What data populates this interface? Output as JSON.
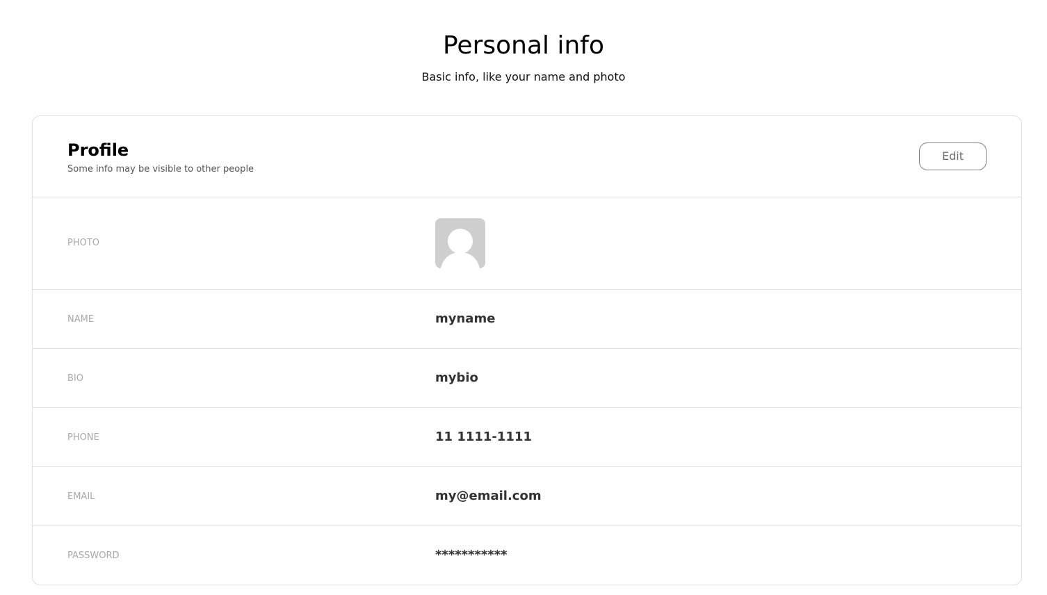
{
  "header": {
    "title": "Personal info",
    "subtitle": "Basic info, like your name and photo"
  },
  "profile": {
    "title": "Profile",
    "subtitle": "Some info may be visible to other people",
    "edit_label": "Edit",
    "photo_label": "PHOTO",
    "avatar_icon": "user-silhouette-icon",
    "fields": [
      {
        "label": "NAME",
        "value": "myname"
      },
      {
        "label": "BIO",
        "value": "mybio"
      },
      {
        "label": "PHONE",
        "value": "11 1111-1111"
      },
      {
        "label": "EMAIL",
        "value": "my@email.com"
      },
      {
        "label": "PASSWORD",
        "value": "***********"
      }
    ]
  },
  "colors": {
    "border": "#e0e0e0",
    "label": "#a8a8a8",
    "value": "#333333",
    "avatar_bg": "#cfcfcf"
  }
}
